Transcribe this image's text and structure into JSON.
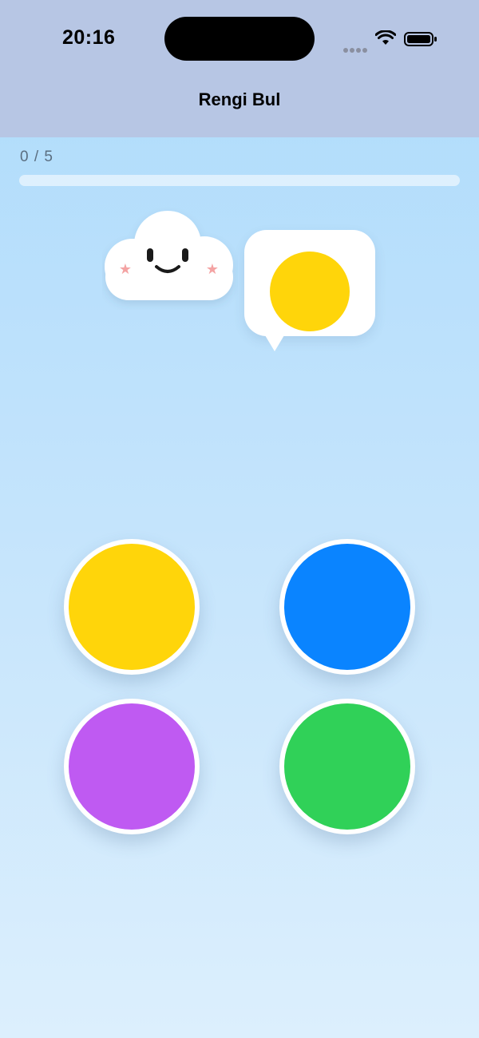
{
  "status_bar": {
    "time": "20:16",
    "icons": [
      "signal-dots-icon",
      "wifi-icon",
      "battery-icon"
    ]
  },
  "nav": {
    "title": "Rengi Bul"
  },
  "progress": {
    "label": "0 / 5",
    "current": 0,
    "total": 5
  },
  "mascot": {
    "icon": "cloud-mascot-icon"
  },
  "target": {
    "color": "#FFD50A"
  },
  "choices": [
    {
      "name": "yellow",
      "color": "#FFD50A"
    },
    {
      "name": "blue",
      "color": "#0A84FF"
    },
    {
      "name": "purple",
      "color": "#BF5AF2"
    },
    {
      "name": "green",
      "color": "#30D158"
    }
  ]
}
